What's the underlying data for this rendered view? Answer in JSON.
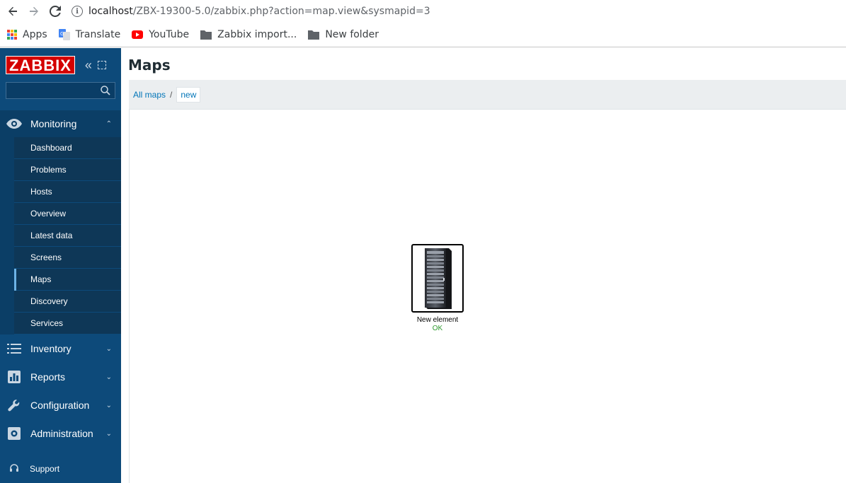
{
  "browser": {
    "url_host": "localhost",
    "url_path": "/ZBX-19300-5.0/zabbix.php?action=map.view&sysmapid=3",
    "bookmarks": [
      {
        "label": "Apps",
        "icon": "apps-icon"
      },
      {
        "label": "Translate",
        "icon": "google-translate-icon"
      },
      {
        "label": "YouTube",
        "icon": "youtube-icon"
      },
      {
        "label": "Zabbix import...",
        "icon": "folder-icon"
      },
      {
        "label": "New folder",
        "icon": "folder-icon"
      }
    ]
  },
  "sidebar": {
    "logo": "ZABBIX",
    "search_value": "",
    "sections": {
      "monitoring": "Monitoring",
      "inventory": "Inventory",
      "reports": "Reports",
      "configuration": "Configuration",
      "administration": "Administration"
    },
    "monitoring_items": [
      "Dashboard",
      "Problems",
      "Hosts",
      "Overview",
      "Latest data",
      "Screens",
      "Maps",
      "Discovery",
      "Services"
    ],
    "support": "Support"
  },
  "main": {
    "title": "Maps",
    "breadcrumb": {
      "parent": "All maps",
      "separator": "/",
      "current": "new"
    },
    "map_element": {
      "label": "New element",
      "status": "OK",
      "icon": "server-rack-icon"
    }
  },
  "colors": {
    "sidebar_bg": "#0d4a7a",
    "logo_bg": "#d40000",
    "link": "#0275b8",
    "status_ok": "#2e9a2e"
  }
}
